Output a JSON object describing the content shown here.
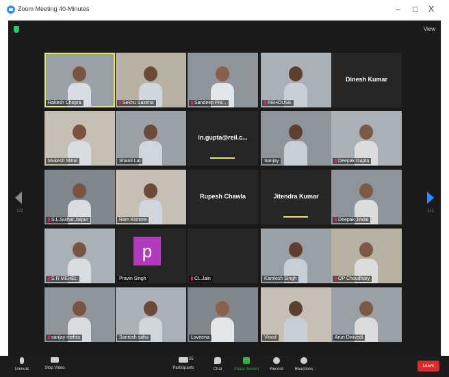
{
  "window": {
    "title": "Zoom Meeting 40-Minutes",
    "minimize": "–",
    "maximize": "□",
    "close": "X"
  },
  "header": {
    "view_label": "View"
  },
  "pagination": {
    "prev_page": "1/2",
    "next_page": "1/2"
  },
  "tiles": [
    {
      "id": "rakesh-chopra",
      "name": "Rakesh Chopra",
      "muted": false,
      "type": "video"
    },
    {
      "id": "sekhu-saxena",
      "name": "Sekhu Saxena",
      "muted": true,
      "type": "video"
    },
    {
      "id": "sandeep-pra",
      "name": "Sandeep Pra...",
      "muted": true,
      "type": "video"
    },
    {
      "id": "rehouse",
      "name": "REHOUSE",
      "muted": true,
      "type": "video"
    },
    {
      "id": "dinesh-kumar",
      "name": "Dinesh Kumar",
      "type": "name"
    },
    {
      "id": "mukesh",
      "name": "Mukesh Mittal",
      "muted": false,
      "type": "video"
    },
    {
      "id": "shanti",
      "name": "Shanti Lal",
      "muted": false,
      "type": "video"
    },
    {
      "id": "ln-gupta",
      "name": "ln.gupta@reil.c...",
      "type": "name"
    },
    {
      "id": "sanjay",
      "name": "Sanjay",
      "muted": false,
      "type": "video"
    },
    {
      "id": "deepak-gupta",
      "name": "Deepak Gupta",
      "muted": true,
      "type": "video"
    },
    {
      "id": "sl-suthar",
      "name": "S.L.Suthar,Jaipur",
      "muted": true,
      "type": "video"
    },
    {
      "id": "ram-kishore",
      "name": "Ram Kishore",
      "muted": false,
      "type": "video"
    },
    {
      "id": "rupesh-chawla",
      "name": "Rupesh Chawla",
      "type": "name"
    },
    {
      "id": "jitendra-kumar",
      "name": "Jitendra Kumar",
      "type": "name"
    },
    {
      "id": "deepak-jindal",
      "name": "Deepak Jindal",
      "muted": true,
      "type": "video"
    },
    {
      "id": "sr-wadhwa",
      "name": "S R MEHEL",
      "muted": true,
      "type": "video"
    },
    {
      "id": "pravin-singh",
      "name": "Pravin Singh",
      "muted": false,
      "type": "avatar",
      "letter": "p"
    },
    {
      "id": "cl-jain",
      "name": "CL.Jain",
      "muted": true,
      "type": "blank"
    },
    {
      "id": "kamlesh-singh",
      "name": "Kamlesh Singh",
      "muted": false,
      "type": "video"
    },
    {
      "id": "op-choudhary",
      "name": "OP Choudhary",
      "muted": true,
      "type": "video"
    },
    {
      "id": "sanjay-mehra",
      "name": "sanjay mehra",
      "muted": true,
      "type": "video"
    },
    {
      "id": "santosh-sahu",
      "name": "Santosh sahu",
      "muted": false,
      "type": "video"
    },
    {
      "id": "loveena",
      "name": "Loveena",
      "muted": false,
      "type": "video"
    },
    {
      "id": "vinod",
      "name": "Vinod",
      "muted": false,
      "type": "video"
    },
    {
      "id": "arun-dwivedi",
      "name": "Arun Dwivedi",
      "muted": false,
      "type": "video"
    }
  ],
  "toolbar": {
    "unmute": "Unmute",
    "stop_video": "Stop Video",
    "participants": "Participants",
    "participants_count": "25",
    "chat": "Chat",
    "share_screen": "Share Screen",
    "record": "Record",
    "reactions": "Reactions",
    "leave": "Leave"
  },
  "colors": {
    "accent": "#2d8cff",
    "leave": "#d92d2d",
    "active_speaker": "#e6e65a",
    "share_green": "#2db34a"
  }
}
